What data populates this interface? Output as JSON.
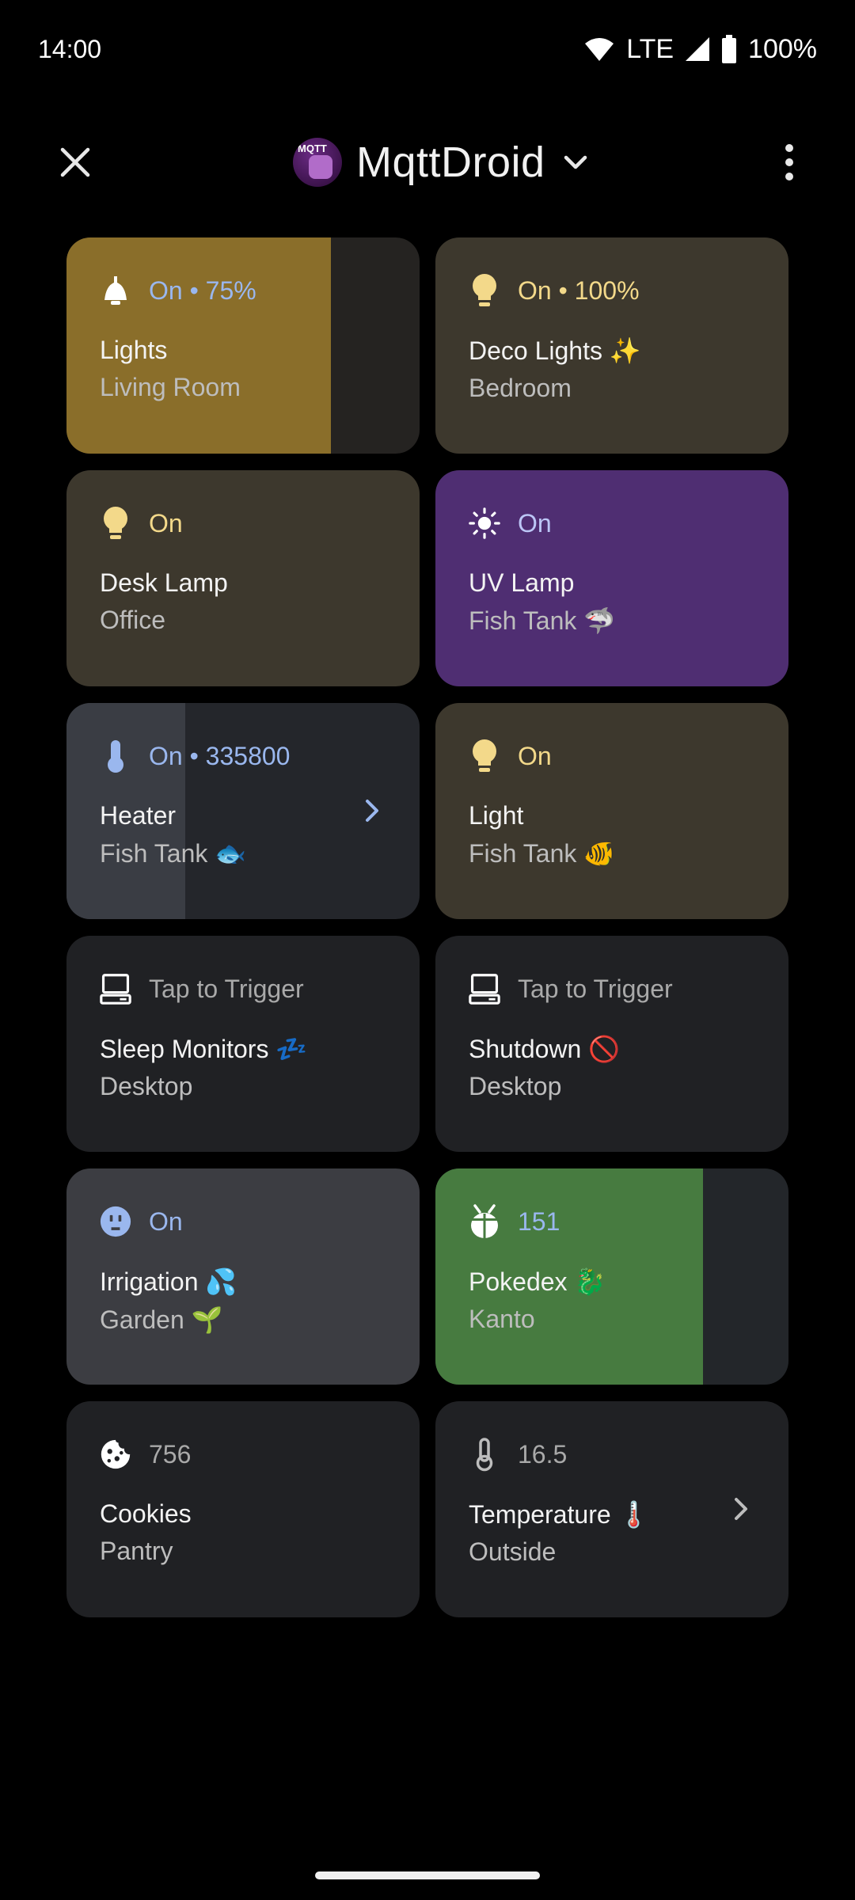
{
  "status_bar": {
    "time": "14:00",
    "network": "LTE",
    "battery": "100%"
  },
  "app_bar": {
    "title": "MqttDroid",
    "logo_text": "MQTT"
  },
  "tiles": [
    {
      "state": "On • 75%",
      "name": "Lights",
      "room": "Living Room",
      "icon": "bell-lamp-icon",
      "level": 0.75
    },
    {
      "state": "On • 100%",
      "name": "Deco Lights ✨",
      "room": "Bedroom",
      "icon": "bulb-icon",
      "level": 1.0
    },
    {
      "state": "On",
      "name": "Desk Lamp",
      "room": "Office",
      "icon": "bulb-icon"
    },
    {
      "state": "On",
      "name": "UV Lamp",
      "room": "Fish Tank 🦈",
      "icon": "sun-icon"
    },
    {
      "state": "On • 335800",
      "name": "Heater",
      "room": "Fish Tank 🐟",
      "icon": "thermometer-icon"
    },
    {
      "state": "On",
      "name": "Light",
      "room": "Fish Tank 🐠",
      "icon": "bulb-icon"
    },
    {
      "state": "Tap to Trigger",
      "name": "Sleep Monitors 💤",
      "room": "Desktop",
      "icon": "computer-icon"
    },
    {
      "state": "Tap to Trigger",
      "name": "Shutdown 🚫",
      "room": "Desktop",
      "icon": "computer-icon"
    },
    {
      "state": "On",
      "name": "Irrigation 💦",
      "room": "Garden 🌱",
      "icon": "outlet-icon"
    },
    {
      "state": "151",
      "name": "Pokedex 🐉",
      "room": "Kanto",
      "icon": "bug-icon"
    },
    {
      "state": "756",
      "name": "Cookies",
      "room": "Pantry",
      "icon": "cookie-icon"
    },
    {
      "state": "16.5",
      "name": "Temperature 🌡️",
      "room": "Outside",
      "icon": "thermometer-icon"
    }
  ]
}
